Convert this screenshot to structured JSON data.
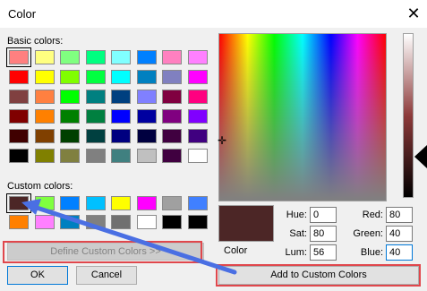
{
  "window": {
    "title": "Color",
    "close_glyph": "✕"
  },
  "labels": {
    "basic": "Basic colors:",
    "custom": "Custom colors:",
    "color": "Color"
  },
  "basic_colors": [
    [
      "#ff8080",
      "#ffff80",
      "#80ff80",
      "#00ff80",
      "#80ffff",
      "#0080ff",
      "#ff80c0",
      "#ff80ff"
    ],
    [
      "#ff0000",
      "#ffff00",
      "#80ff00",
      "#00ff40",
      "#00ffff",
      "#0080c0",
      "#8080c0",
      "#ff00ff"
    ],
    [
      "#804040",
      "#ff8040",
      "#00ff00",
      "#008080",
      "#004080",
      "#8080ff",
      "#800040",
      "#ff0080"
    ],
    [
      "#800000",
      "#ff8000",
      "#008000",
      "#008040",
      "#0000ff",
      "#0000a0",
      "#800080",
      "#8000ff"
    ],
    [
      "#400000",
      "#804000",
      "#004000",
      "#004040",
      "#000080",
      "#000040",
      "#400040",
      "#400080"
    ],
    [
      "#000000",
      "#808000",
      "#808040",
      "#808080",
      "#408080",
      "#c0c0c0",
      "#400040",
      "#ffffff"
    ]
  ],
  "custom_colors": [
    [
      "#4c2626",
      "#80ff40",
      "#0080ff",
      "#00c0ff",
      "#ffff00",
      "#ff00ff",
      "#a0a0a0",
      "#4080ff"
    ],
    [
      "#ff8000",
      "#ff80ff",
      "#0080c0",
      "#808080",
      "#707070",
      "#ffffff",
      "#000000",
      "#000000"
    ]
  ],
  "buttons": {
    "define": "Define Custom Colors >>",
    "ok": "OK",
    "cancel": "Cancel",
    "add": "Add to Custom Colors"
  },
  "fields": {
    "hue": {
      "label": "Hue:",
      "value": "0"
    },
    "sat": {
      "label": "Sat:",
      "value": "80"
    },
    "lum": {
      "label": "Lum:",
      "value": "56"
    },
    "red": {
      "label": "Red:",
      "value": "80"
    },
    "green": {
      "label": "Green:",
      "value": "40"
    },
    "blue": {
      "label": "Blue:",
      "value": "40"
    }
  },
  "current_color": "#4c2626",
  "annotation_color": "#4a6fe3",
  "highlight_color": "#e0474c"
}
